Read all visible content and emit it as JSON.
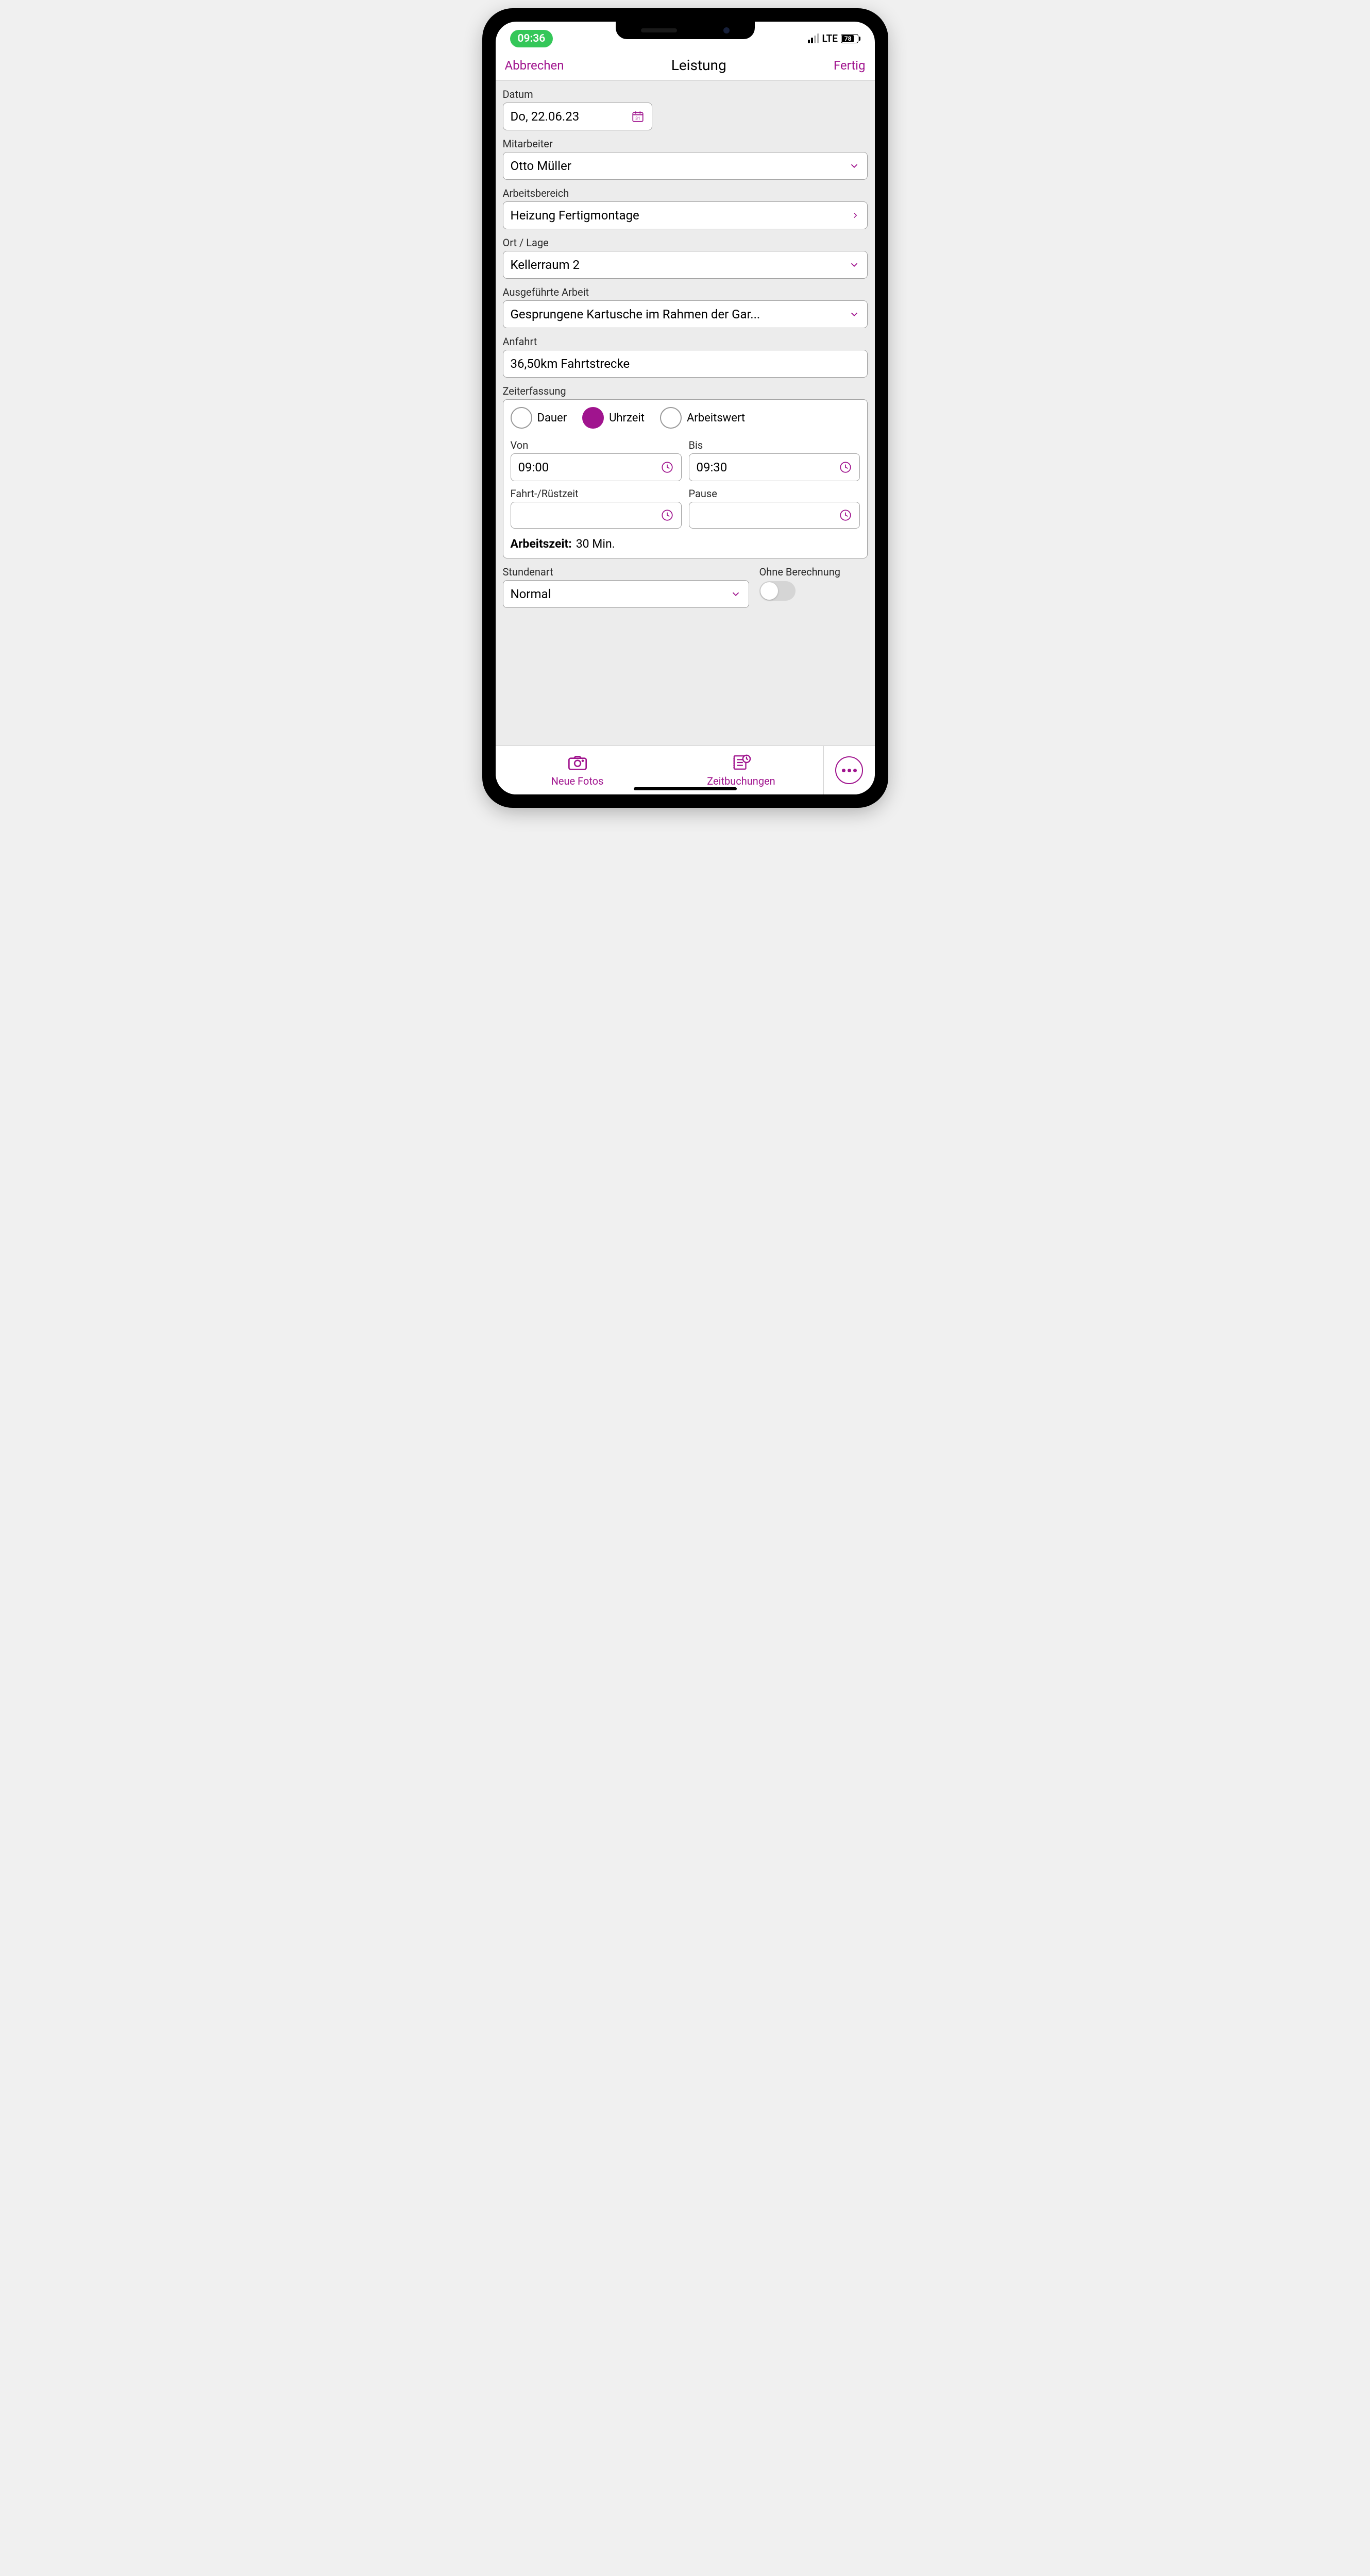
{
  "status": {
    "time": "09:36",
    "network": "LTE",
    "battery": "78"
  },
  "nav": {
    "cancel": "Abbrechen",
    "title": "Leistung",
    "done": "Fertig"
  },
  "form": {
    "datum_label": "Datum",
    "datum_value": "Do, 22.06.23",
    "mitarbeiter_label": "Mitarbeiter",
    "mitarbeiter_value": "Otto Müller",
    "arbeitsbereich_label": "Arbeitsbereich",
    "arbeitsbereich_value": "Heizung Fertigmontage",
    "ort_label": "Ort / Lage",
    "ort_value": "Kellerraum 2",
    "arbeit_label": "Ausgeführte Arbeit",
    "arbeit_value": "Gesprungene Kartusche im Rahmen der Gar...",
    "anfahrt_label": "Anfahrt",
    "anfahrt_value": "36,50km Fahrtstrecke",
    "zeit_label": "Zeiterfassung",
    "radios": {
      "dauer": "Dauer",
      "uhrzeit": "Uhrzeit",
      "arbeitswert": "Arbeitswert"
    },
    "von_label": "Von",
    "von_value": "09:00",
    "bis_label": "Bis",
    "bis_value": "09:30",
    "fahrt_label": "Fahrt-/Rüstzeit",
    "fahrt_value": "",
    "pause_label": "Pause",
    "pause_value": "",
    "arbeitszeit_prefix": "Arbeitszeit:",
    "arbeitszeit_value": "30 Min.",
    "stundenart_label": "Stundenart",
    "stundenart_value": "Normal",
    "ohne_label": "Ohne Berechnung"
  },
  "bottom": {
    "fotos": "Neue Fotos",
    "zeit": "Zeitbuchungen"
  },
  "colors": {
    "accent": "#a0148e"
  }
}
